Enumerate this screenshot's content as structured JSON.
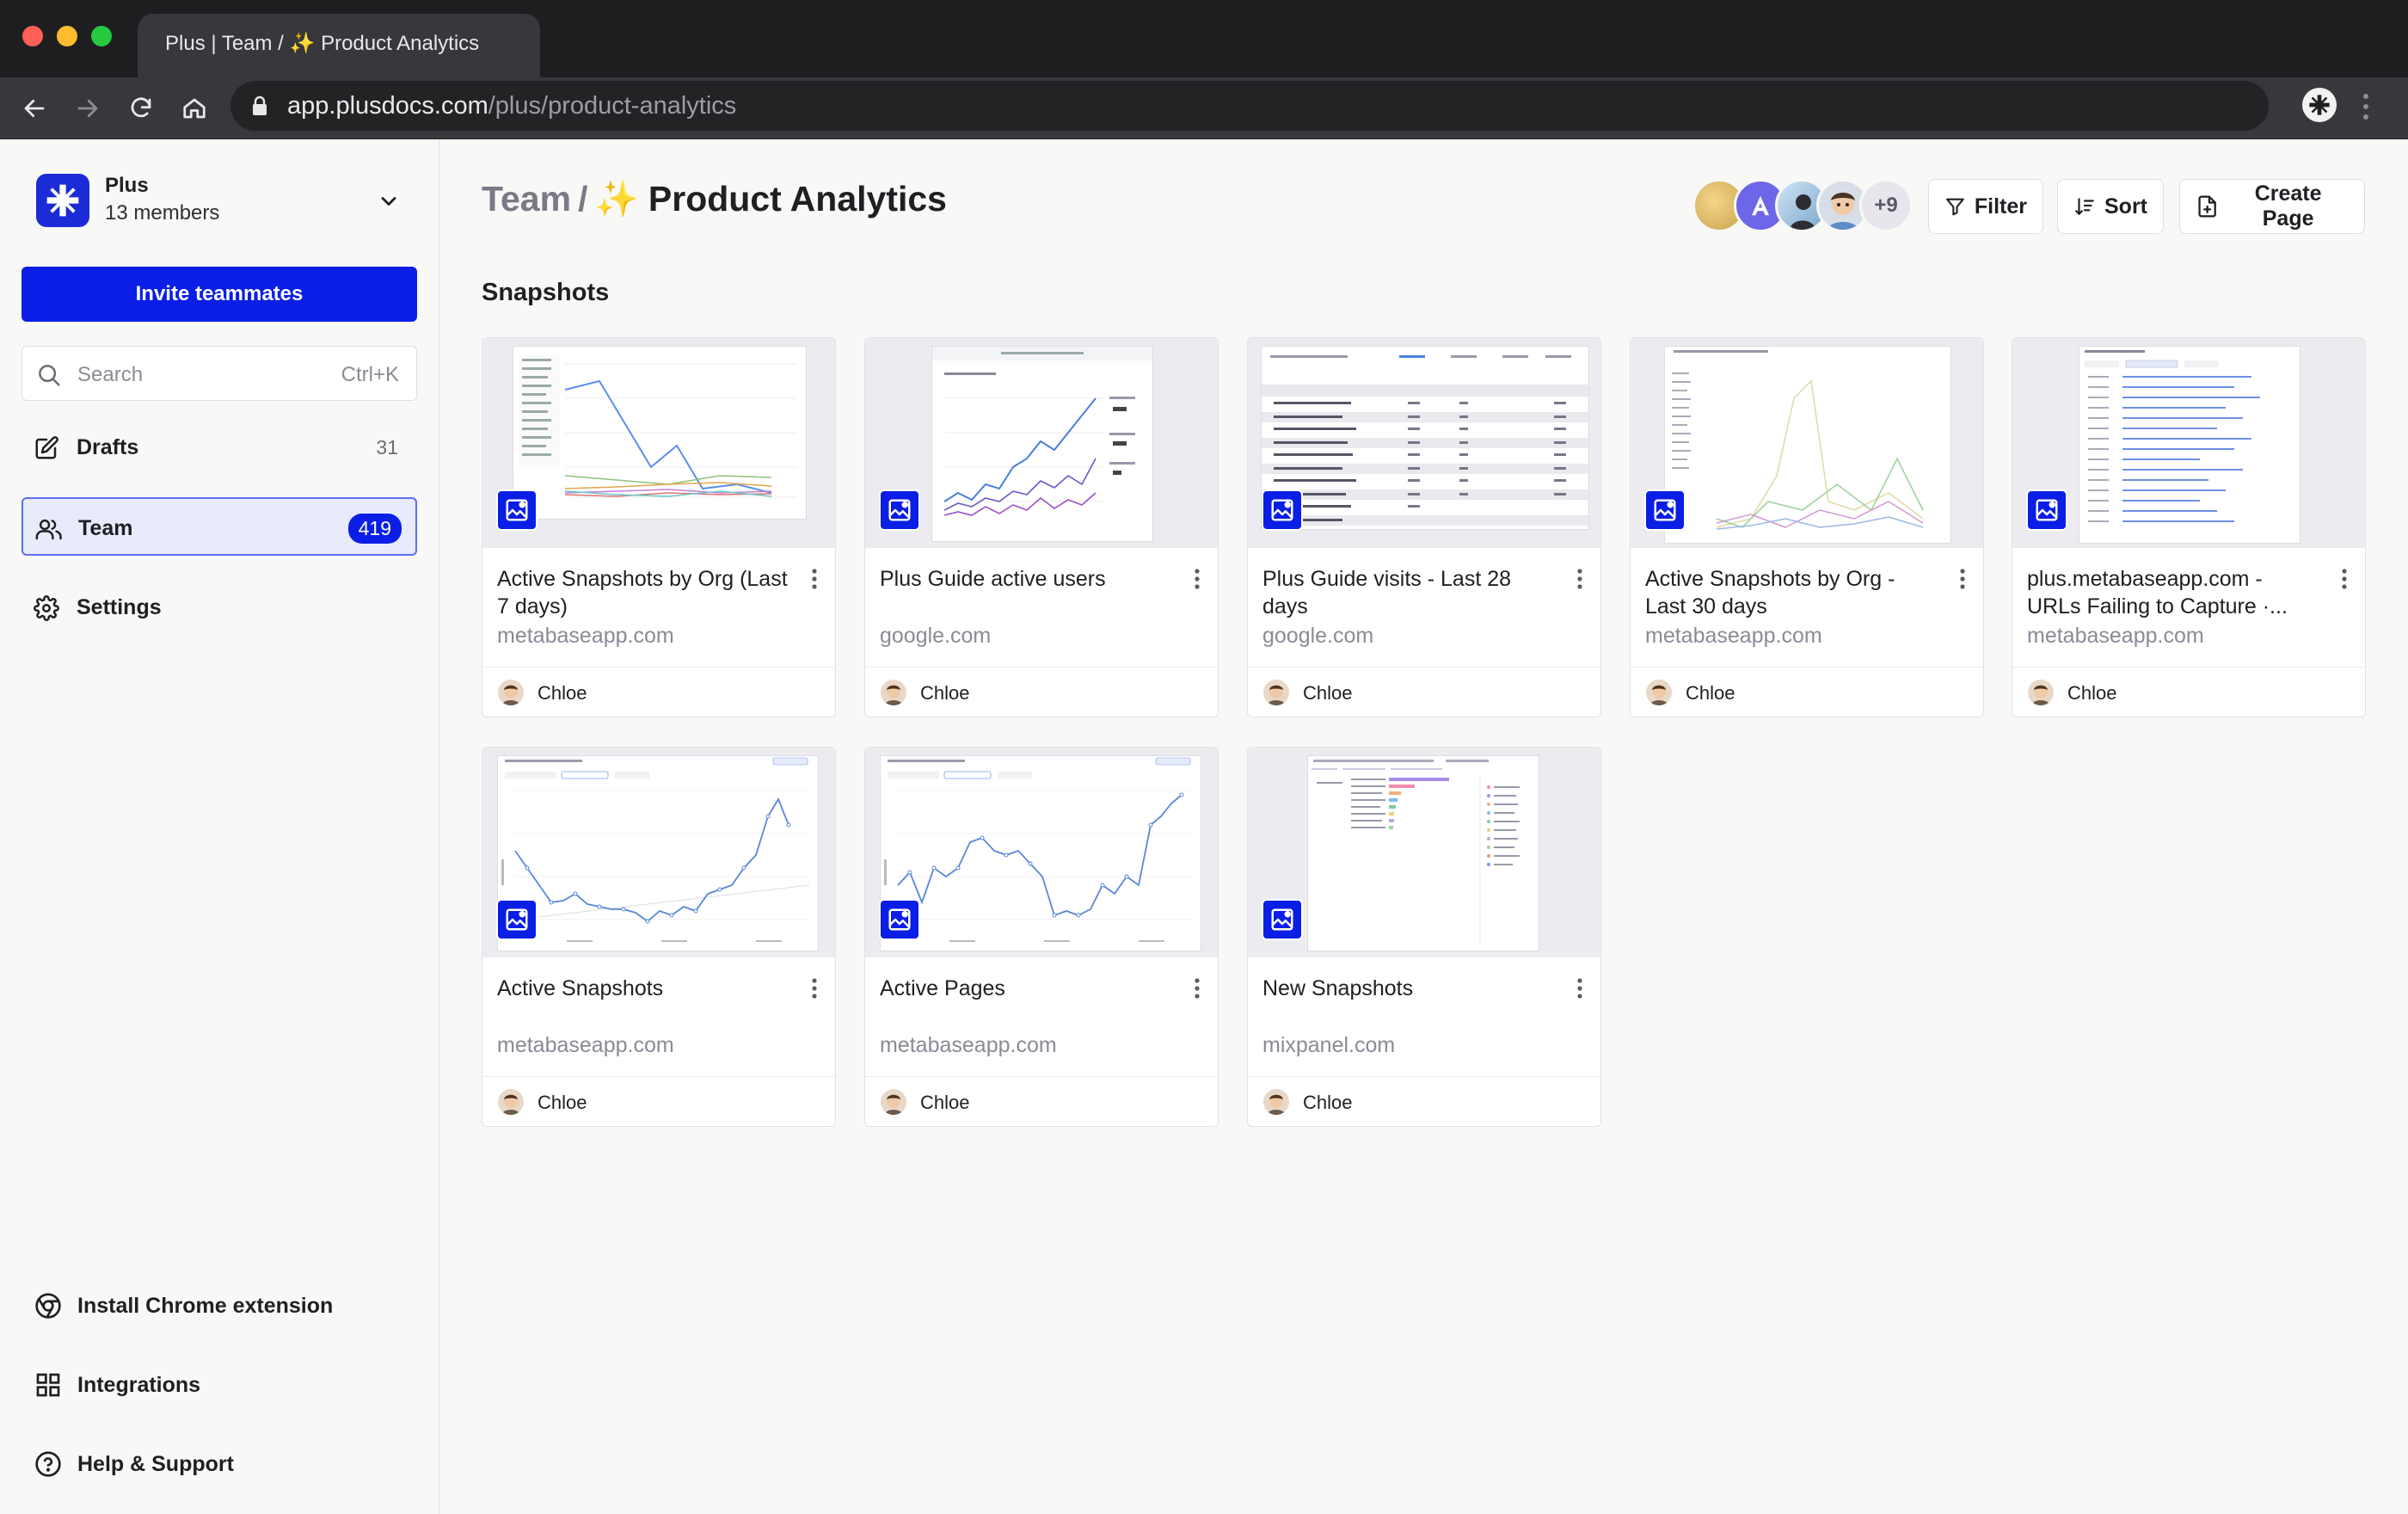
{
  "browser": {
    "tab_title": "Plus | Team / ✨ Product Analytics",
    "url_host": "app.plusdocs.com",
    "url_path": "/plus/product-analytics"
  },
  "sidebar": {
    "workspace_name": "Plus",
    "workspace_members": "13 members",
    "invite_label": "Invite teammates",
    "search_placeholder": "Search",
    "search_shortcut": "Ctrl+K",
    "nav": [
      {
        "label": "Drafts",
        "count": "31",
        "icon": "edit-icon"
      },
      {
        "label": "Team",
        "count": "419",
        "icon": "people-icon",
        "active": true
      },
      {
        "label": "Settings",
        "count": "",
        "icon": "gear-icon"
      }
    ],
    "footer": [
      {
        "label": "Install Chrome extension",
        "icon": "chrome-icon"
      },
      {
        "label": "Integrations",
        "icon": "grid-icon"
      },
      {
        "label": "Help & Support",
        "icon": "help-icon"
      }
    ]
  },
  "header": {
    "breadcrumb_team": "Team",
    "breadcrumb_sep": "/",
    "page_title": "✨ Product Analytics",
    "avatar_more": "+9",
    "filter_label": "Filter",
    "sort_label": "Sort",
    "create_label": "Create Page"
  },
  "section_title": "Snapshots",
  "cards": [
    {
      "title": "Active Snapshots by Org (Last 7 days)",
      "domain": "metabaseapp.com",
      "owner": "Chloe"
    },
    {
      "title": "Plus Guide active users",
      "domain": "google.com",
      "owner": "Chloe"
    },
    {
      "title": "Plus Guide visits - Last 28 days",
      "domain": "google.com",
      "owner": "Chloe"
    },
    {
      "title": "Active Snapshots by Org - Last 30 days",
      "domain": "metabaseapp.com",
      "owner": "Chloe"
    },
    {
      "title": "plus.metabaseapp.com - URLs Failing to Capture ·...",
      "domain": "metabaseapp.com",
      "owner": "Chloe"
    },
    {
      "title": "Active Snapshots",
      "domain": "metabaseapp.com",
      "owner": "Chloe"
    },
    {
      "title": "Active Pages",
      "domain": "metabaseapp.com",
      "owner": "Chloe"
    },
    {
      "title": "New Snapshots",
      "domain": "mixpanel.com",
      "owner": "Chloe"
    }
  ],
  "colors": {
    "accent": "#0b1ee6",
    "active_nav_bg": "#e7ebfb"
  }
}
